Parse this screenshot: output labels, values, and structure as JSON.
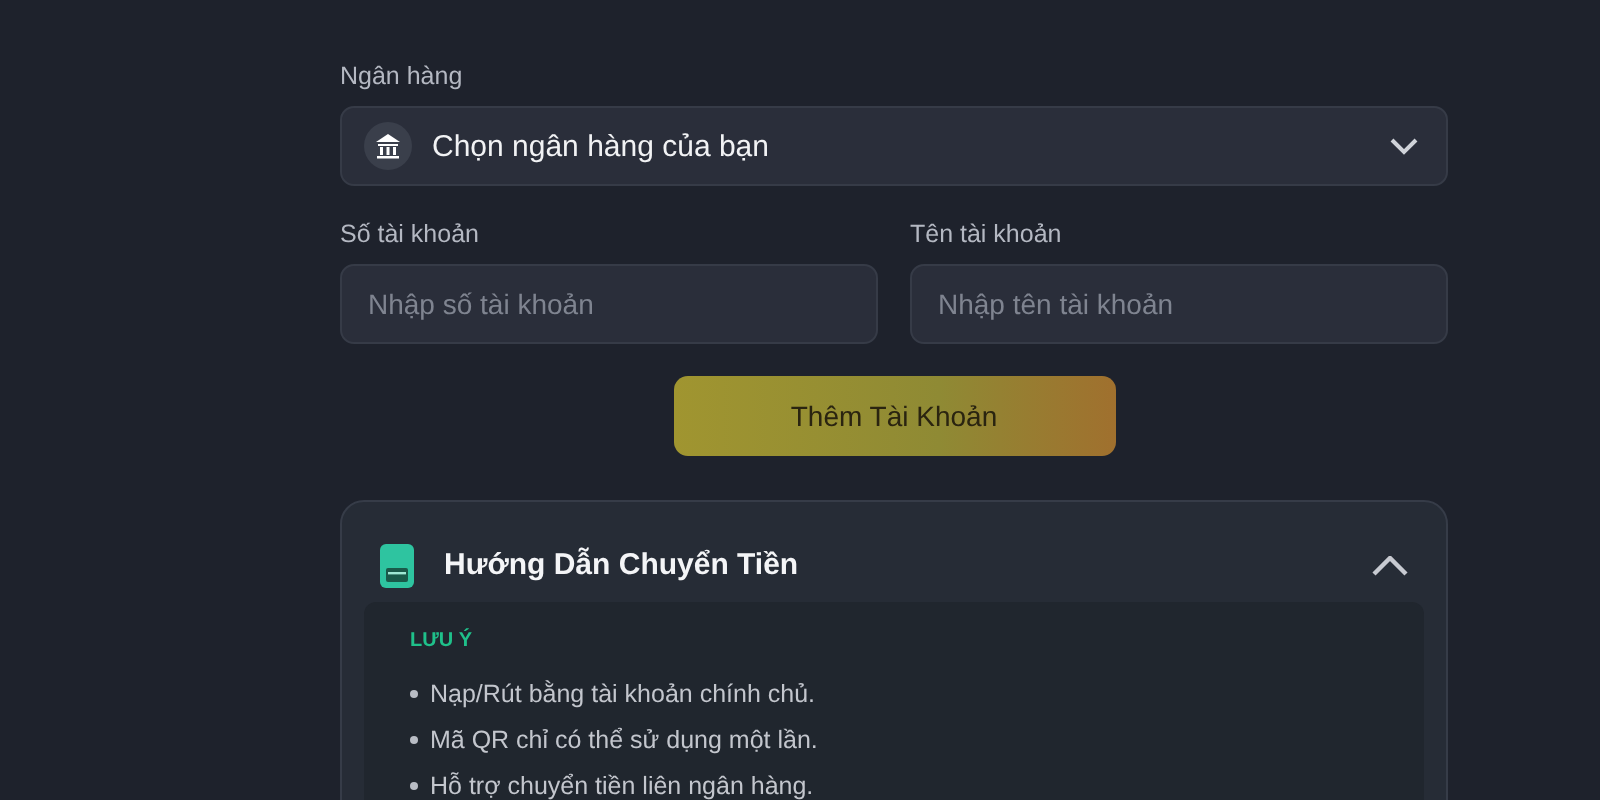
{
  "bank_field": {
    "label": "Ngân hàng",
    "placeholder": "Chọn ngân hàng của bạn"
  },
  "account_fields": [
    {
      "label": "Số tài khoản",
      "placeholder": "Nhập số tài khoản"
    },
    {
      "label": "Tên tài khoản",
      "placeholder": "Nhập tên tài khoản"
    }
  ],
  "add_button": "Thêm Tài Khoản",
  "guide": {
    "title": "Hướng Dẫn Chuyển Tiền",
    "expanded": true,
    "note_heading": "LƯU Ý",
    "notes": [
      "Nạp/Rút bằng tài khoản chính chủ.",
      "Mã QR chỉ có thể sử dụng một lần.",
      "Hỗ trợ chuyển tiền liên ngân hàng."
    ]
  }
}
